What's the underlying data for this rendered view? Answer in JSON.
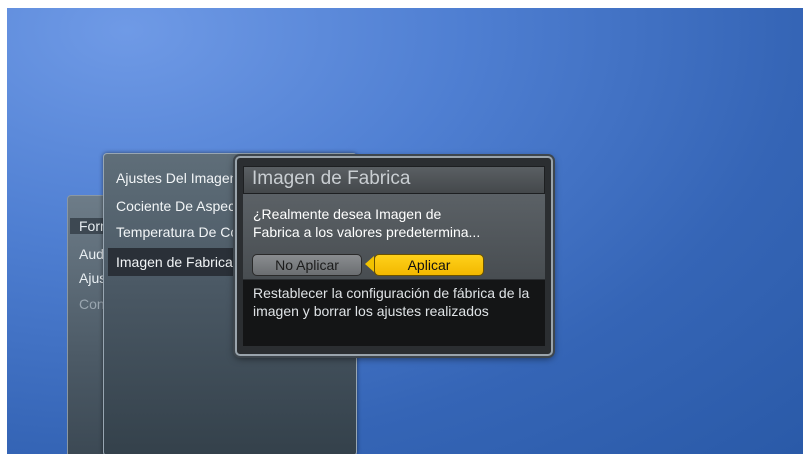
{
  "back_menu": {
    "items": [
      {
        "label": "Formato de Entrada"
      },
      {
        "label": "Audio"
      },
      {
        "label": "Ajuste Imagen"
      },
      {
        "label": "Consumo de Energía"
      }
    ]
  },
  "mid_menu": {
    "items": [
      {
        "label": "Ajustes Del Imagen"
      },
      {
        "label": "Cociente De Aspecto"
      },
      {
        "label": "Temperatura De Color"
      },
      {
        "label": "Imagen de Fabrica"
      }
    ]
  },
  "dialog": {
    "title": "Imagen de Fabrica",
    "question_line1": "¿Realmente desea Imagen de",
    "question_line2": "Fabrica a los valores predetermina...",
    "no_label": "No Aplicar",
    "yes_label": "Aplicar",
    "help_text": "Restablecer la configuración de fábrica de la imagen y borrar los ajustes realizados"
  },
  "colors": {
    "selected": "#f2c200",
    "background": "#3565b6"
  }
}
